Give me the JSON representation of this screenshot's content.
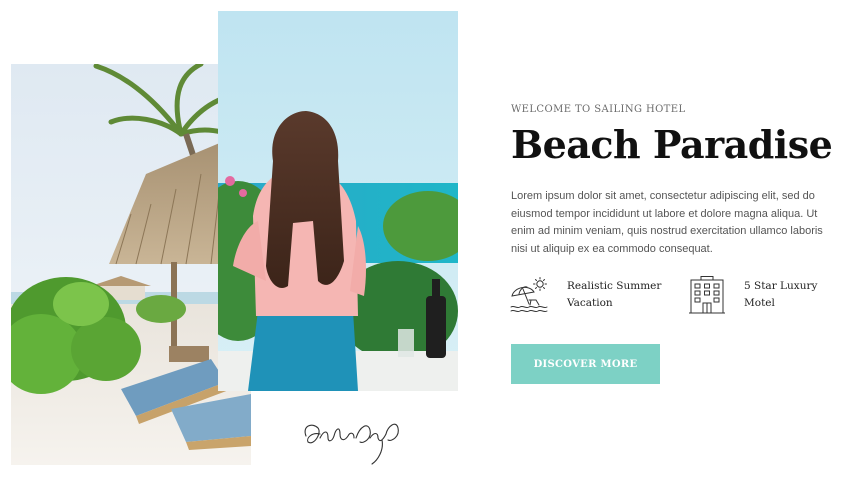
{
  "hero": {
    "eyebrow": "WELCOME TO SAILING HOTEL",
    "title": "Beach Paradise",
    "description": "Lorem ipsum dolor sit amet, consectetur adipiscing elit, sed do eiusmod tempor incididunt ut labore et dolore magna aliqua. Ut enim ad minim veniam, quis nostrud exercitation ullamco laboris nisi ut aliquip ex ea commodo consequat.",
    "cta_label": "DISCOVER MORE"
  },
  "features": [
    {
      "icon": "beach-umbrella-icon",
      "label": "Realistic Summer Vacation"
    },
    {
      "icon": "hotel-building-icon",
      "label": "5 Star Luxury Motel"
    }
  ],
  "photos": [
    {
      "subject": "beach-resort-photo"
    },
    {
      "subject": "woman-at-sea-photo"
    }
  ],
  "colors": {
    "accent": "#7dd1c5",
    "title": "#111111",
    "body": "#555555",
    "eyebrow": "#6b6b6b"
  }
}
